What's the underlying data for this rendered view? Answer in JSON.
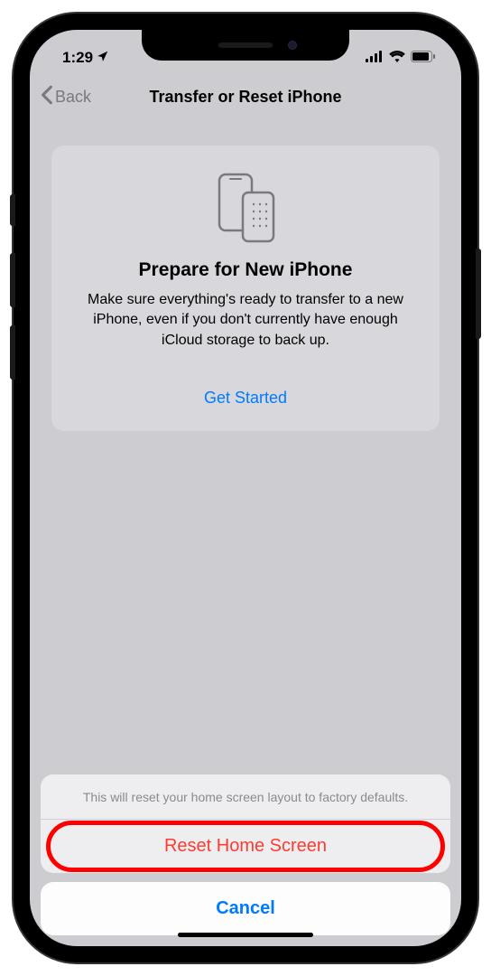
{
  "status": {
    "time": "1:29",
    "signal": true,
    "wifi": true,
    "battery": true
  },
  "nav": {
    "back_label": "Back",
    "title": "Transfer or Reset iPhone"
  },
  "card": {
    "title": "Prepare for New iPhone",
    "description": "Make sure everything's ready to transfer to a new iPhone, even if you don't currently have enough iCloud storage to back up.",
    "link_label": "Get Started"
  },
  "action_sheet": {
    "message": "This will reset your home screen layout to factory defaults.",
    "destructive_label": "Reset Home Screen",
    "cancel_label": "Cancel"
  }
}
